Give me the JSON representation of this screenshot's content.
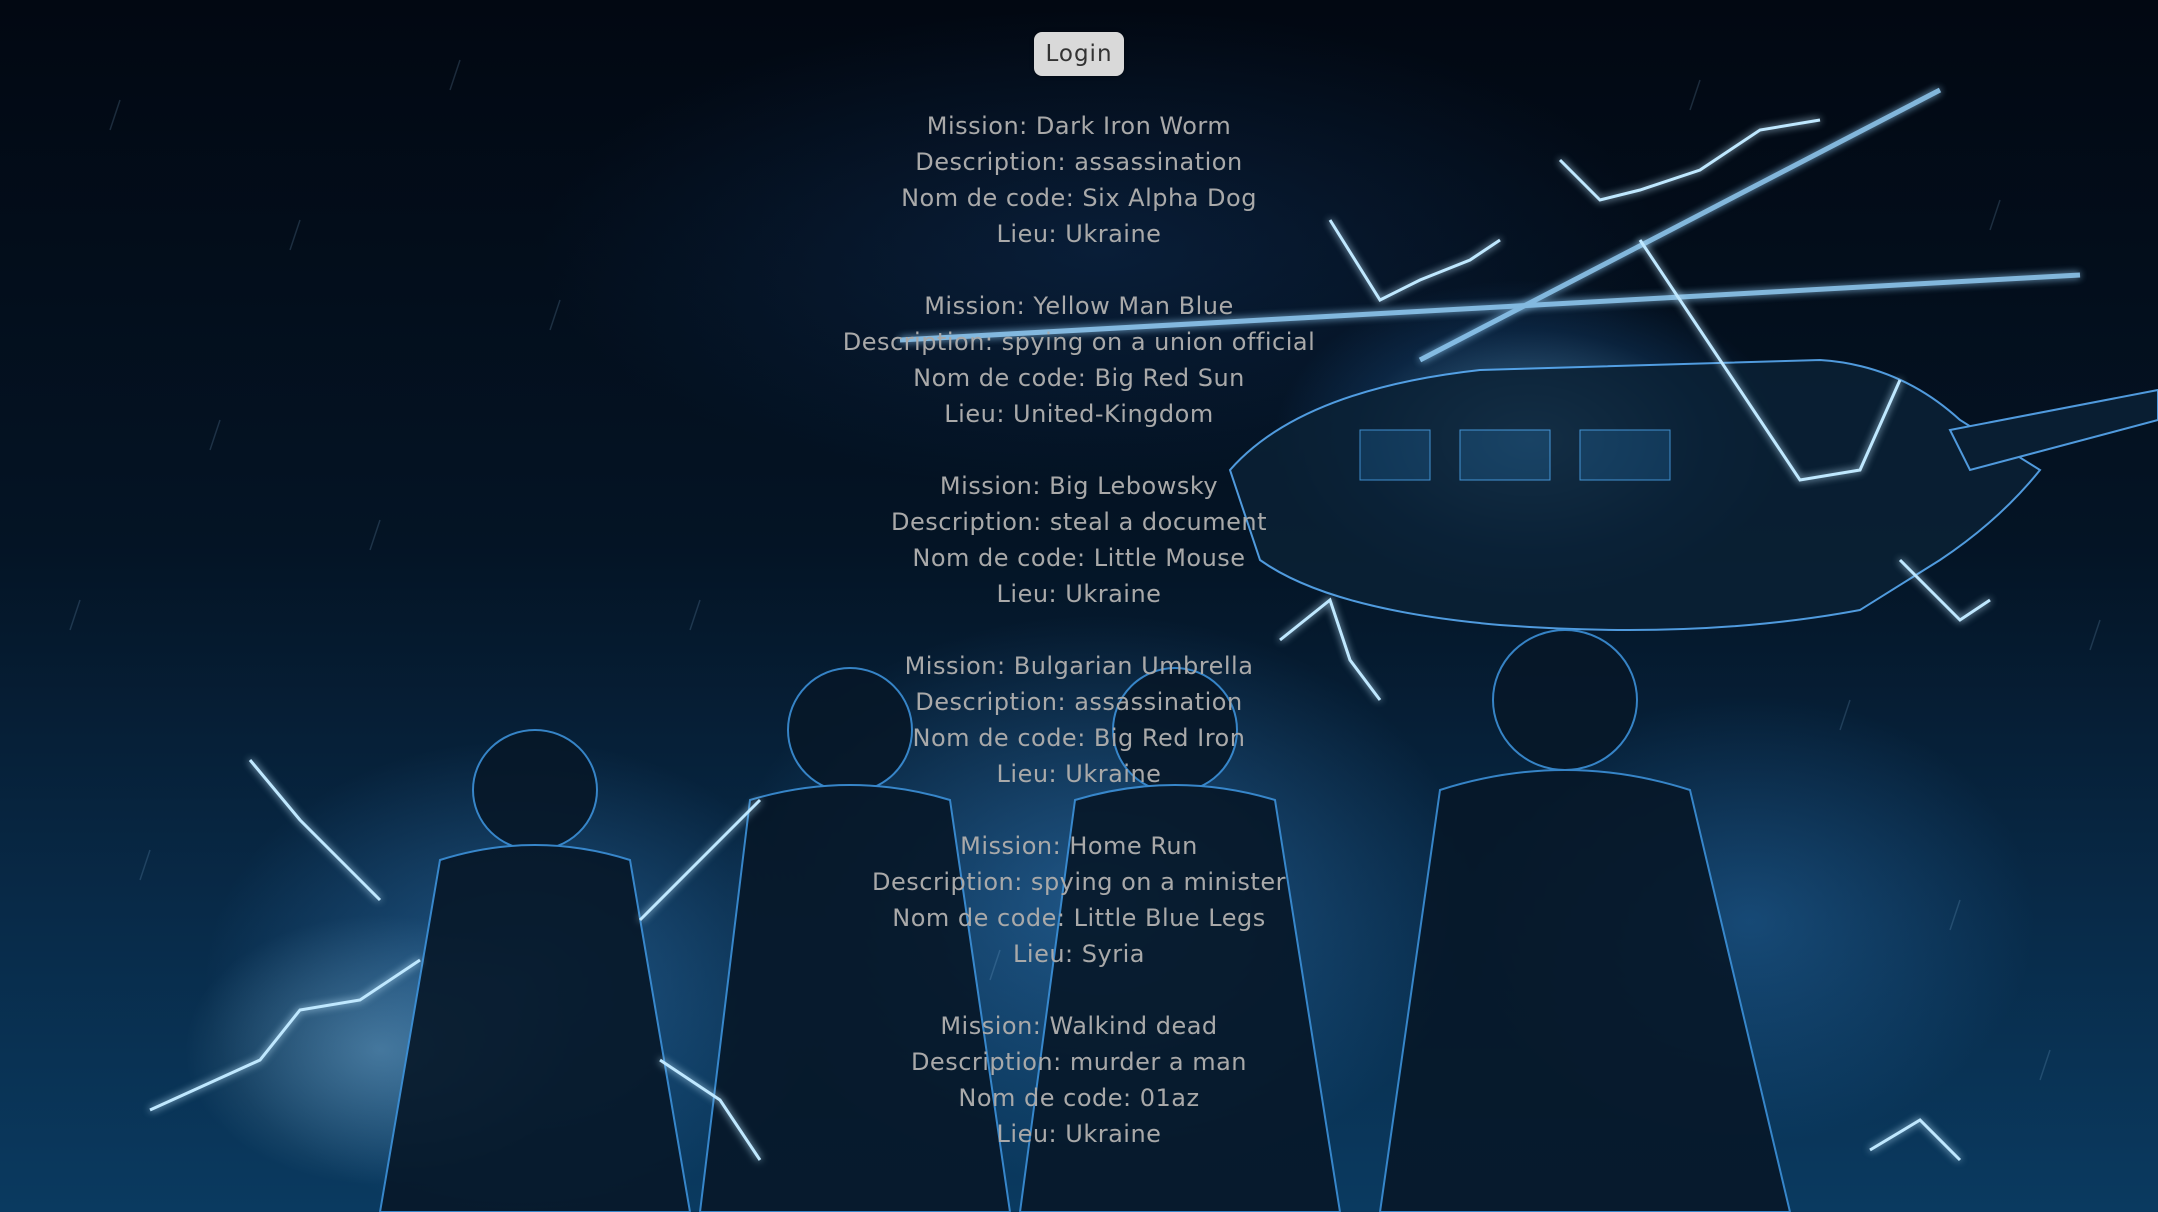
{
  "header": {
    "login_label": "Login"
  },
  "missions": [
    {
      "mission": "Mission: Dark Iron Worm",
      "description": "Description: assassination",
      "codename": "Nom de code: Six Alpha Dog",
      "location": "Lieu: Ukraine"
    },
    {
      "mission": "Mission: Yellow Man Blue",
      "description": "Description: spying on a union official",
      "codename": "Nom de code: Big Red Sun",
      "location": "Lieu: United-Kingdom"
    },
    {
      "mission": "Mission: Big Lebowsky",
      "description": "Description: steal a document",
      "codename": "Nom de code: Little Mouse",
      "location": "Lieu: Ukraine"
    },
    {
      "mission": "Mission: Bulgarian Umbrella",
      "description": "Description: assassination",
      "codename": "Nom de code: Big Red Iron",
      "location": "Lieu: Ukraine"
    },
    {
      "mission": "Mission: Home Run",
      "description": "Description: spying on a minister",
      "codename": "Nom de code: Little Blue Legs",
      "location": "Lieu: Syria"
    },
    {
      "mission": "Mission: Walkind dead",
      "description": "Description: murder a man",
      "codename": "Nom de code: 01az",
      "location": "Lieu: Ukraine"
    }
  ],
  "colors": {
    "text": "#a9a9a9",
    "button_bg": "#d9d9d9",
    "background_accent": "#0a3a60"
  }
}
